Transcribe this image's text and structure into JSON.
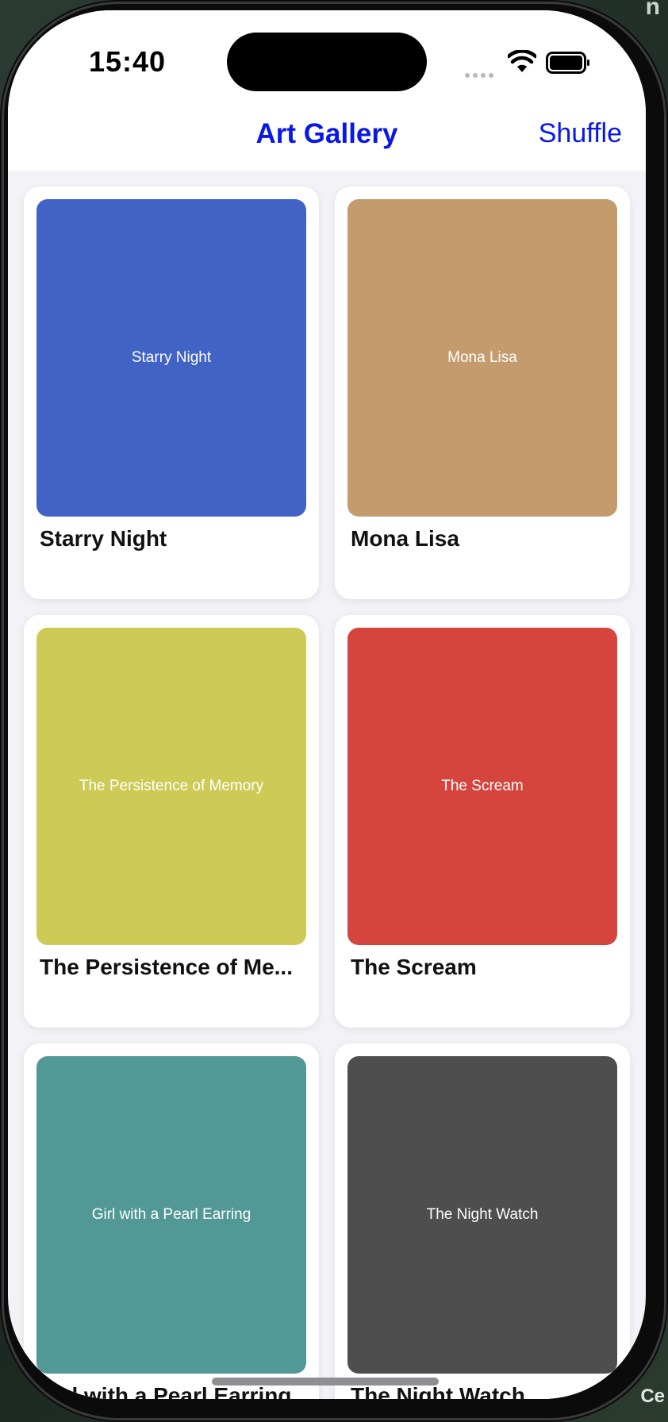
{
  "status_bar": {
    "time": "15:40"
  },
  "nav": {
    "title": "Art Gallery",
    "shuffle_label": "Shuffle"
  },
  "backdrop": {
    "corner_top_right": "n",
    "corner_bottom_right": "Ce"
  },
  "artworks": [
    {
      "title": "Starry Night",
      "label": "Starry Night",
      "color": "#4163c6"
    },
    {
      "title": "Mona Lisa",
      "label": "Mona Lisa",
      "color": "#c49b6d"
    },
    {
      "title": "The Persistence of Me...",
      "label": "The Persistence of Memory",
      "color": "#cdca55"
    },
    {
      "title": "The Scream",
      "label": "The Scream",
      "color": "#d5453e"
    },
    {
      "title": "Girl with a Pearl Earring",
      "label": "Girl with a Pearl Earring",
      "color": "#529896"
    },
    {
      "title": "The Night Watch",
      "label": "The Night Watch",
      "color": "#4e4e4e"
    }
  ],
  "colors": {
    "accent": "#0a18e6",
    "screen_bg": "#f2f2f7",
    "card_bg": "#ffffff"
  },
  "icons": [
    "wifi-icon",
    "battery-icon",
    "signal-dots-icon"
  ]
}
